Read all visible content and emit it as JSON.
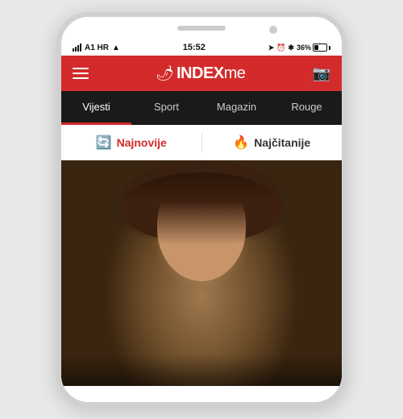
{
  "phone": {
    "status_bar": {
      "carrier": "A1 HR",
      "time": "15:52",
      "battery_percent": "36%"
    },
    "nav_bar": {
      "logo_text": "INDEXme",
      "logo_index": "INDEX",
      "logo_me": "me"
    },
    "category_tabs": [
      {
        "id": "vijesti",
        "label": "Vijesti",
        "active": true
      },
      {
        "id": "sport",
        "label": "Sport",
        "active": false
      },
      {
        "id": "magazin",
        "label": "Magazin",
        "active": false
      },
      {
        "id": "rouge",
        "label": "Rouge",
        "active": false
      }
    ],
    "sub_tabs": [
      {
        "id": "najnovije",
        "label": "Najnovije",
        "icon": "🔄",
        "active": true
      },
      {
        "id": "najcitanije",
        "label": "Najčitanije",
        "icon": "🔥",
        "active": false
      }
    ]
  }
}
